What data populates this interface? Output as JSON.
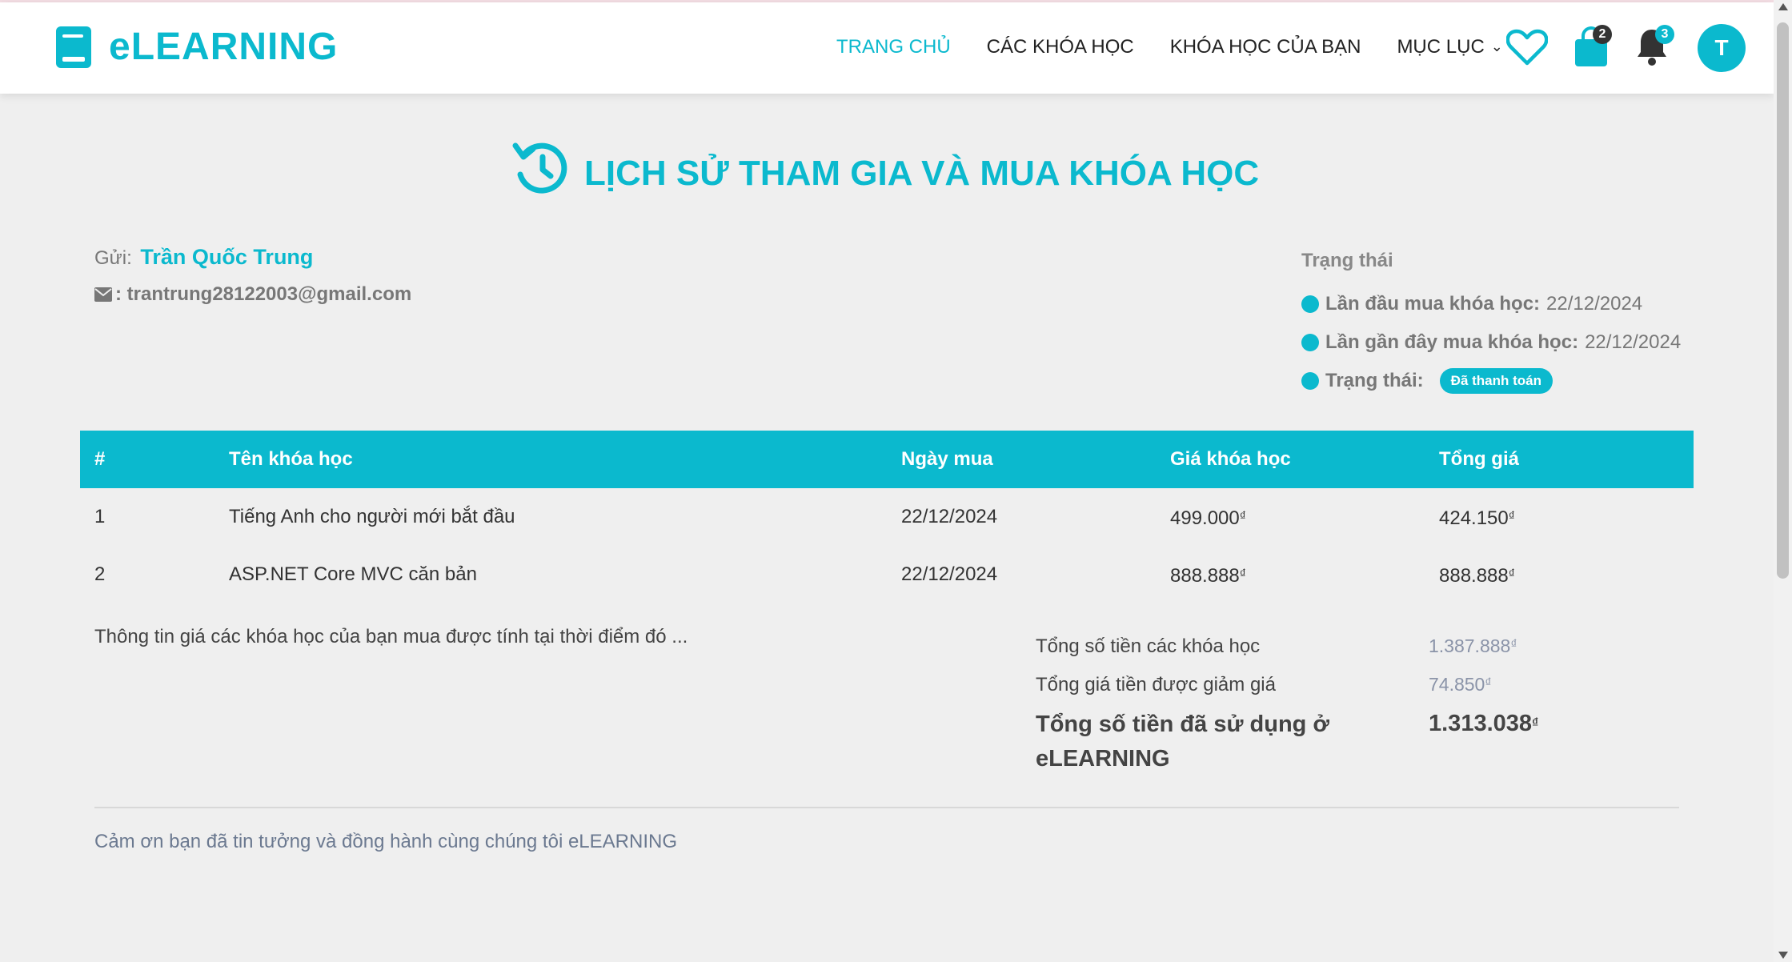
{
  "brand": {
    "name": "eLEARNING"
  },
  "nav": {
    "items": [
      {
        "label": "TRANG CHỦ"
      },
      {
        "label": "CÁC KHÓA HỌC"
      },
      {
        "label": "KHÓA HỌC CỦA BẠN"
      },
      {
        "label": "MỤC LỤC"
      }
    ],
    "cart_count": "2",
    "notification_count": "3",
    "avatar_initial": "T"
  },
  "page": {
    "title": "LỊCH SỬ THAM GIA VÀ MUA KHÓA HỌC"
  },
  "customer": {
    "sender_label": "Gửi:",
    "name": "Trần Quốc Trung",
    "email": ": trantrung28122003@gmail.com"
  },
  "status": {
    "heading": "Trạng thái",
    "first_purchase_label": "Lần đầu mua khóa học:",
    "first_purchase_value": "22/12/2024",
    "latest_purchase_label": "Lần gần đây mua khóa học:",
    "latest_purchase_value": "22/12/2024",
    "state_label": "Trạng thái:",
    "state_value": "Đã thanh toán"
  },
  "table": {
    "headers": [
      "#",
      "Tên khóa học",
      "Ngày mua",
      "Giá khóa học",
      "Tổng giá"
    ],
    "rows": [
      {
        "index": "1",
        "course": "Tiếng Anh cho người mới bắt đầu",
        "date": "22/12/2024",
        "price": "499.000",
        "total": "424.150"
      },
      {
        "index": "2",
        "course": "ASP.NET Core MVC căn bản",
        "date": "22/12/2024",
        "price": "888.888",
        "total": "888.888"
      }
    ],
    "currency": "₫"
  },
  "summary": {
    "note": "Thông tin giá các khóa học của bạn mua được tính tại thời điểm đó ...",
    "subtotal_label": "Tổng số tiền các khóa học",
    "subtotal_value": "1.387.888",
    "discount_label": "Tổng giá tiền được giảm giá",
    "discount_value": "74.850",
    "total_label": "Tổng số tiền đã sử dụng ở eLEARNING",
    "total_value": "1.313.038"
  },
  "footer": {
    "thanks": "Cảm ơn bạn đã tin tưởng và đồng hành cùng chúng tôi eLEARNING"
  },
  "colors": {
    "accent": "#0bb9ce",
    "background": "#efefef",
    "badge_dark": "#333333"
  }
}
